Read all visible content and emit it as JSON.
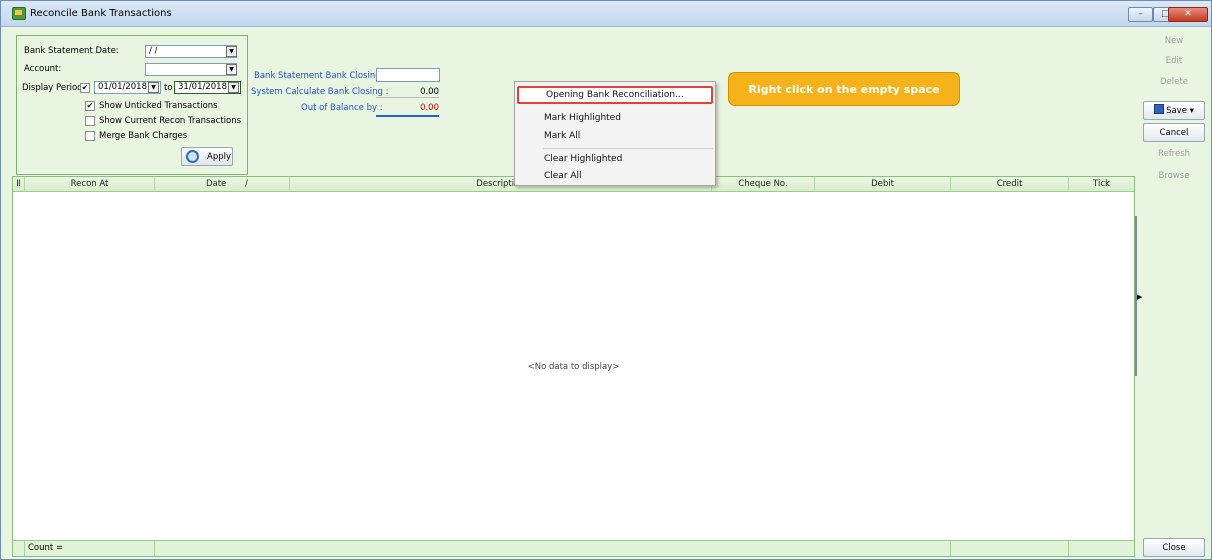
{
  "window": {
    "title": "Reconcile Bank Transactions",
    "minimize_label": "–",
    "maximize_label": "□",
    "close_label": "✕"
  },
  "filter": {
    "statement_date_label": "Bank Statement Date:",
    "statement_date_value": "/ /",
    "account_label": "Account:",
    "account_value": "",
    "display_period_label": "Display Period",
    "period_from": "01/01/2018",
    "to_label": "to",
    "period_to": "31/01/2018",
    "checkbox_display_period_checked": true,
    "checkboxes": [
      {
        "label": "Show Unticked Transactions",
        "checked": true
      },
      {
        "label": "Show Current Recon Transactions",
        "checked": false
      },
      {
        "label": "Merge Bank Charges",
        "checked": false
      }
    ],
    "apply_label": "Apply"
  },
  "balances": {
    "bank_closing_label": "Bank Statement  Bank Closing :",
    "bank_closing_value": "",
    "system_closing_label": "System Calculate Bank Closing :",
    "system_closing_value": "0.00",
    "out_of_balance_label": "Out of Balance by :",
    "out_of_balance_value": "0.00"
  },
  "context_menu": {
    "items": [
      "Opening Bank Reconciliation...",
      "Mark Highlighted",
      "Mark All",
      "Clear Highlighted",
      "Clear All"
    ]
  },
  "callout": {
    "text": "Right click on the empty space"
  },
  "grid": {
    "columns": [
      "Recon At",
      "Date",
      "/",
      "Description",
      "Cheque No.",
      "Debit",
      "Credit",
      "Tick"
    ],
    "empty_text": "<No data to display>",
    "footer_count": "Count ="
  },
  "side_buttons": [
    "New",
    "Edit",
    "Delete",
    "Save",
    "Cancel",
    "Refresh",
    "Browse"
  ],
  "close_button": "Close"
}
